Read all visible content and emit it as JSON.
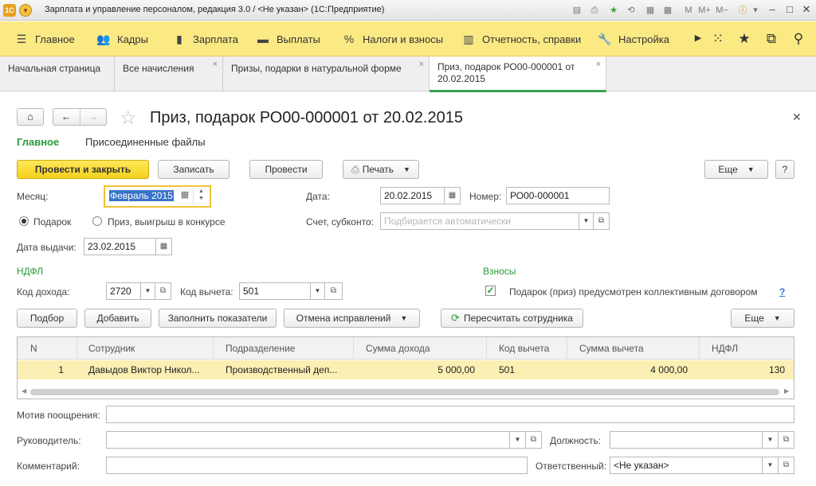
{
  "window": {
    "title": "Зарплата и управление персоналом, редакция 3.0 / <Не указан>  (1С:Предприятие)"
  },
  "menu": {
    "items": [
      {
        "label": "Главное",
        "icon": "hamburger-icon"
      },
      {
        "label": "Кадры",
        "icon": "people-icon"
      },
      {
        "label": "Зарплата",
        "icon": "book-icon"
      },
      {
        "label": "Выплаты",
        "icon": "wallet-icon"
      },
      {
        "label": "Налоги и взносы",
        "icon": "percent-icon"
      },
      {
        "label": "Отчетность, справки",
        "icon": "report-icon"
      },
      {
        "label": "Настройка",
        "icon": "wrench-icon"
      }
    ]
  },
  "tabs": [
    {
      "label": "Начальная страница"
    },
    {
      "label": "Все начисления"
    },
    {
      "label": "Призы, подарки в натуральной форме"
    },
    {
      "label": "Приз, подарок РО00-000001 от 20.02.2015"
    }
  ],
  "document": {
    "title": "Приз, подарок РО00-000001 от 20.02.2015",
    "sections": [
      "Главное",
      "Присоединенные файлы"
    ]
  },
  "toolbar": {
    "post_close": "Провести и закрыть",
    "save": "Записать",
    "post": "Провести",
    "print": "Печать",
    "more": "Еще",
    "help": "?"
  },
  "fields": {
    "month_label": "Месяц:",
    "month_value": "Февраль 2015",
    "date_label": "Дата:",
    "date_value": "20.02.2015",
    "number_label": "Номер:",
    "number_value": "РО00-000001",
    "radio_gift": "Подарок",
    "radio_prize": "Приз, выигрыш в конкурсе",
    "account_label": "Счет, субконто:",
    "account_placeholder": "Подбирается автоматически",
    "issue_date_label": "Дата выдачи:",
    "issue_date_value": "23.02.2015",
    "ndfl_header": "НДФЛ",
    "income_code_label": "Код дохода:",
    "income_code_value": "2720",
    "deduction_code_label": "Код вычета:",
    "deduction_code_value": "501",
    "contrib_header": "Взносы",
    "contract_checkbox_label": "Подарок (приз) предусмотрен коллективным договором",
    "contract_help": "?"
  },
  "table_toolbar": {
    "select": "Подбор",
    "add": "Добавить",
    "fill": "Заполнить показатели",
    "cancel_corrections": "Отмена исправлений",
    "recalculate": "Пересчитать сотрудника",
    "more": "Еще"
  },
  "table": {
    "columns": [
      "N",
      "Сотрудник",
      "Подразделение",
      "Сумма дохода",
      "Код вычета",
      "Сумма вычета",
      "НДФЛ"
    ],
    "rows": [
      [
        "1",
        "Давыдов Виктор Никол...",
        "Производственный деп...",
        "5 000,00",
        "501",
        "4 000,00",
        "130"
      ]
    ]
  },
  "footer": {
    "motive_label": "Мотив поощрения:",
    "manager_label": "Руководитель:",
    "position_label": "Должность:",
    "comment_label": "Комментарий:",
    "responsible_label": "Ответственный:",
    "responsible_value": "<Не указан>"
  },
  "colors": {
    "accent_green": "#2a9a3a",
    "menu_yellow": "#fbe984",
    "primary_button": "#f4d11c",
    "row_highlight": "#fbefb3"
  }
}
